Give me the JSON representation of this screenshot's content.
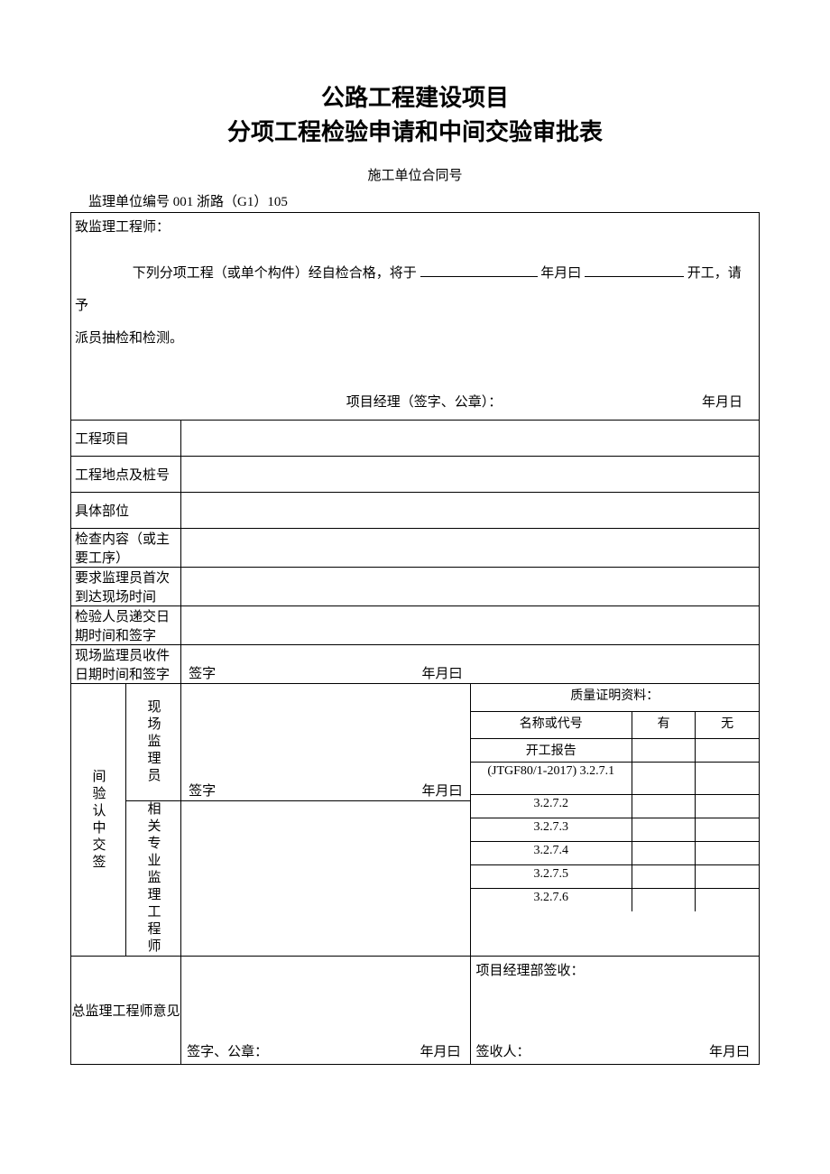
{
  "title_line1": "公路工程建设项目",
  "title_line2": "分项工程检验申请和中间交验审批表",
  "contract_label": "施工单位合同号",
  "ref_no": "监理单位编号 001 浙路（G1）105",
  "top": {
    "salutation": "致监理工程师：",
    "body_pre": "下列分项工程（或单个构件）经自检合格，将于",
    "body_mid": "年月曰",
    "body_tail": "开工，请予",
    "body_line2": "派员抽检和检测。",
    "pm_label": "项目经理（签字、公章）：",
    "date_label": "年月日"
  },
  "fields": {
    "project": "工程项目",
    "location": "工程地点及桩号",
    "part": "具体部位",
    "content": "检查内容（或主要工序）",
    "first_arrival": "要求监理员首次到达现场时间",
    "inspector_sign": "检验人员递交日期时间和签字",
    "site_sign": "现场监理员收件日期时间和签字"
  },
  "middle": {
    "vlabel_main": "间验认中交签",
    "vlabel_sub1": "现场监理员",
    "vlabel_sub2": "相关专业监理工程师",
    "sign_prefix": "签字",
    "date_short": "年月曰"
  },
  "quality": {
    "header": "质量证明资料：",
    "name_label": "名称或代号",
    "yes": "有",
    "no": "无",
    "rows": [
      "开工报告",
      "(JTGF80/1-2017) 3.2.7.1",
      "3.2.7.2",
      "3.2.7.3",
      "3.2.7.4",
      "3.2.7.5",
      "3.2.7.6"
    ]
  },
  "footer": {
    "chief_label": "总监理工程师意见",
    "sign_seal": "签字、公章：",
    "date_short": "年月曰",
    "pm_receipt": "项目经理部签收：",
    "signer": "签收人：",
    "date_full": "年月曰"
  }
}
